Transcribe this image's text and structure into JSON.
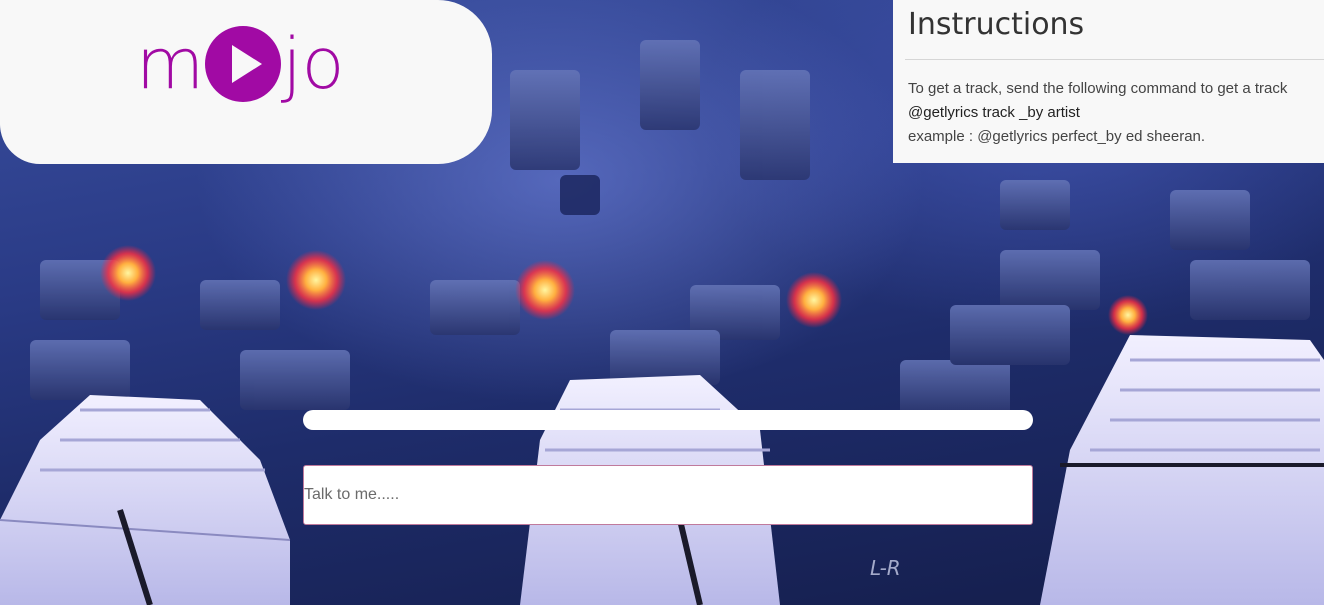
{
  "logo": {
    "text_left": "m",
    "text_right": "jo",
    "icon": "play-circle-icon",
    "color": "#a10aa4"
  },
  "instructions": {
    "title": "Instructions",
    "line1": "To get a track, send the following command to get a track",
    "line2": "@getlyrics track _by artist",
    "line3": "example : @getlyrics perfect_by ed sheeran."
  },
  "progress": {
    "value": 1.0
  },
  "chat": {
    "placeholder": "Talk to me.....",
    "value": ""
  },
  "background": {
    "subject": "audio mixing console faders"
  }
}
